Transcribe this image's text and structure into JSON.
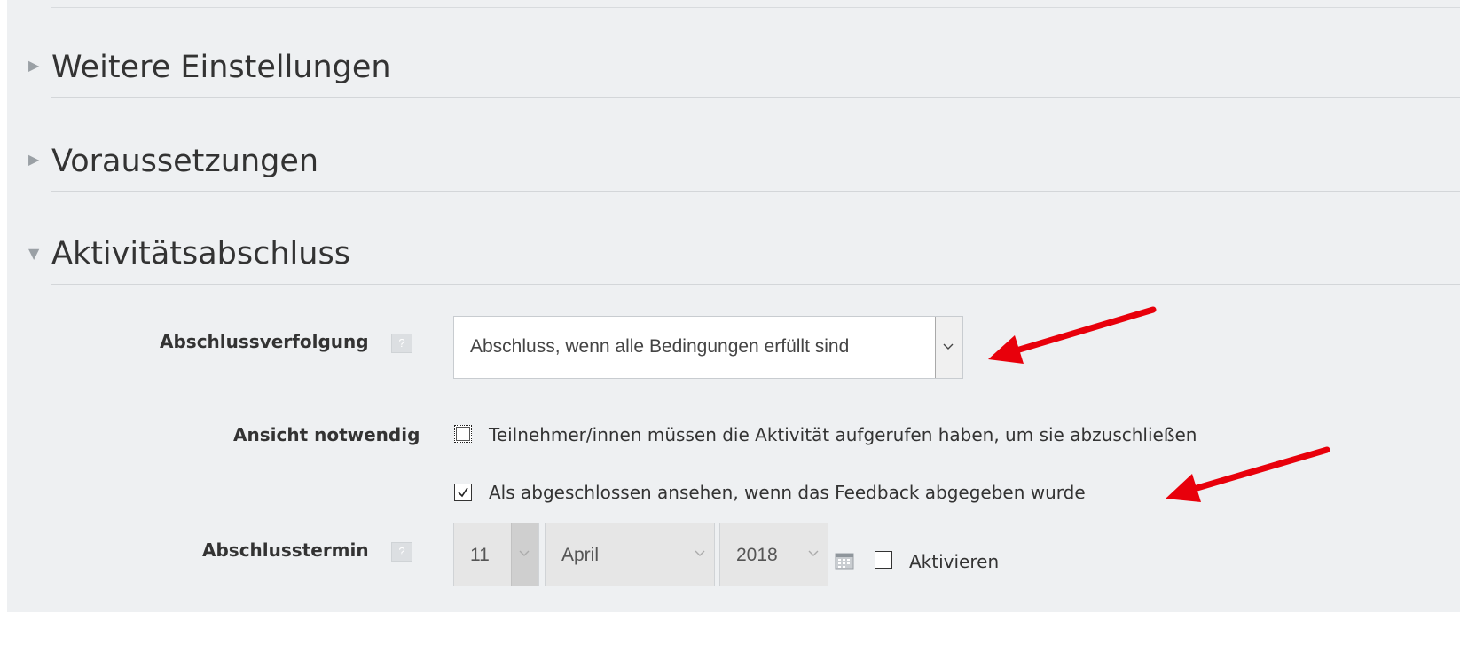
{
  "sections": [
    {
      "title": "Weitere Einstellungen",
      "expanded": false
    },
    {
      "title": "Voraussetzungen",
      "expanded": false
    },
    {
      "title": "Aktivitätsabschluss",
      "expanded": true
    }
  ],
  "completion": {
    "tracking_label": "Abschlussverfolgung",
    "tracking_value": "Abschluss, wenn alle Bedingungen erfüllt sind",
    "view_label": "Ansicht notwendig",
    "view_text": "Teilnehmer/innen müssen die Aktivität aufgerufen haben, um sie abzuschließen",
    "view_checked": false,
    "submit_text": "Als abgeschlossen ansehen, wenn das Feedback abgegeben wurde",
    "submit_checked": true,
    "date_label": "Abschlusstermin",
    "day": "11",
    "month": "April",
    "year": "2018",
    "enable_label": "Aktivieren",
    "enable_checked": false
  },
  "colors": {
    "panel_bg": "#eef0f2",
    "annotation_arrow": "#e8000b"
  },
  "icons": {
    "collapsed": "triangle-right-icon",
    "expanded": "triangle-down-icon",
    "help": "help-icon",
    "calendar": "calendar-icon"
  }
}
